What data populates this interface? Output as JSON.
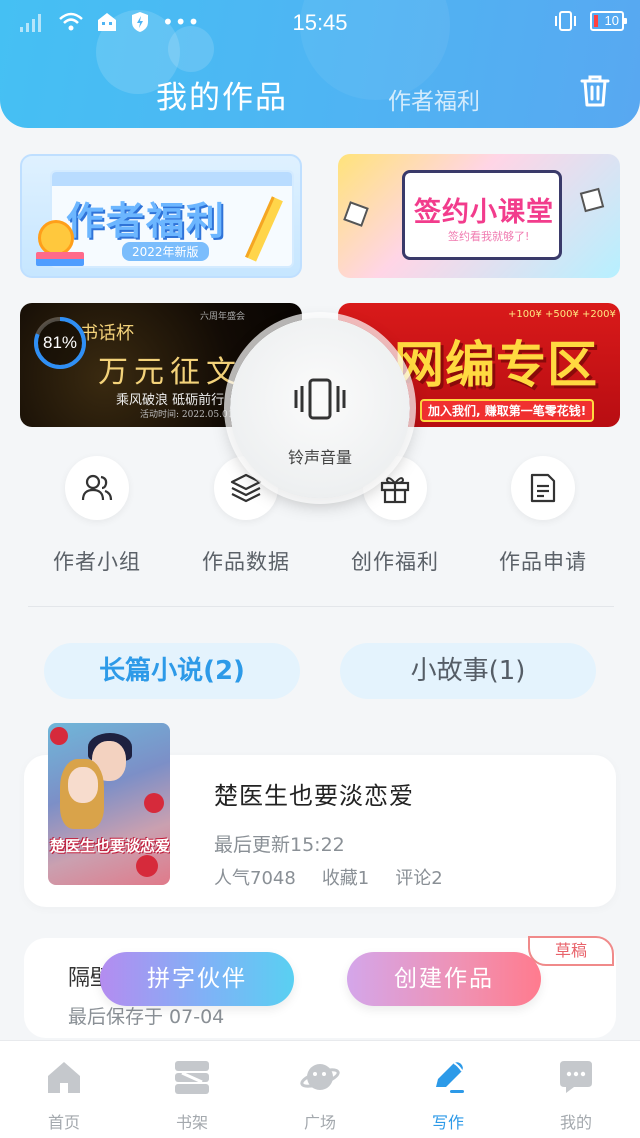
{
  "status_bar": {
    "time": "15:45",
    "battery": "10"
  },
  "header": {
    "active_tab": "我的作品",
    "inactive_tab": "作者福利",
    "trash_icon": "trash-icon"
  },
  "banners": {
    "author_welfare": {
      "title": "作者福利",
      "subtitle": "2022年新版"
    },
    "sign_class": {
      "title": "签约小课堂",
      "subtitle": "签约看我就够了!"
    },
    "essay_contest": {
      "small_header": "六周年盛会",
      "cup": "书话杯",
      "title": "万元征文",
      "slogan": "乘风破浪 砥砺前行",
      "date_line": "活动时间: 2022.05.01-2022.8.31",
      "progress": "81%"
    },
    "editor_zone": {
      "title": "网编专区",
      "subtitle": "加入我们, 赚取第一笔零花钱!",
      "coins": "+100¥ +500¥ +200¥"
    }
  },
  "volume_overlay": {
    "label": "铃声音量",
    "icon": "phone-vibrate-icon"
  },
  "quick_actions": [
    {
      "label": "作者小组",
      "icon": "users-icon"
    },
    {
      "label": "作品数据",
      "icon": "layers-icon"
    },
    {
      "label": "创作福利",
      "icon": "gift-icon"
    },
    {
      "label": "作品申请",
      "icon": "document-icon"
    }
  ],
  "tabs": {
    "long_novel": "长篇小说(2)",
    "short_story": "小故事(1)"
  },
  "work": {
    "cover_text": "楚医生也要谈恋爱",
    "title": "楚医生也要淡恋爱",
    "updated": "最后更新15:22",
    "popularity": "人气7048",
    "favorites": "收藏1",
    "comments": "评论2"
  },
  "draft": {
    "title": "隔壁",
    "saved": "最后保存于 07-04",
    "badge": "草稿"
  },
  "actions": {
    "partner": "拼字伙伴",
    "create": "创建作品"
  },
  "bottom_nav": [
    {
      "label": "首页",
      "icon": "home-icon"
    },
    {
      "label": "书架",
      "icon": "bookshelf-icon"
    },
    {
      "label": "广场",
      "icon": "planet-icon"
    },
    {
      "label": "写作",
      "icon": "pen-icon",
      "active": true
    },
    {
      "label": "我的",
      "icon": "chat-icon"
    }
  ],
  "colors": {
    "header": "#4fb4f3",
    "accent": "#2d9ae8",
    "draft": "#e8636b"
  }
}
